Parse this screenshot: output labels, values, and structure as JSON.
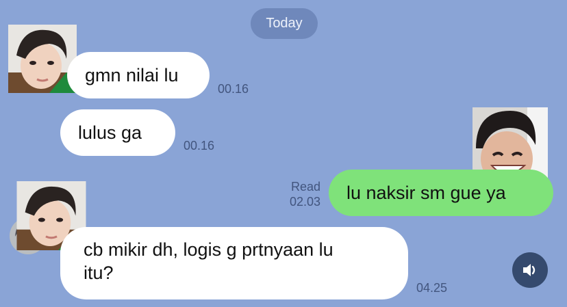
{
  "date_divider": "Today",
  "messages": [
    {
      "text": "gmn nilai lu",
      "time": "00.16",
      "direction": "in"
    },
    {
      "text": "lulus ga",
      "time": "00.16",
      "direction": "in"
    },
    {
      "text": "lu naksir sm gue ya",
      "time": "02.03",
      "status": "Read",
      "direction": "out"
    },
    {
      "text_line1": "cb mikir dh, logis g prtnyaan lu",
      "text_line2": "itu?",
      "time": "04.25",
      "direction": "in"
    }
  ],
  "icons": {
    "speaker": "volume-icon"
  },
  "colors": {
    "background": "#8aa4d6",
    "outgoing_bubble": "#7fe27a",
    "incoming_bubble": "#ffffff"
  }
}
